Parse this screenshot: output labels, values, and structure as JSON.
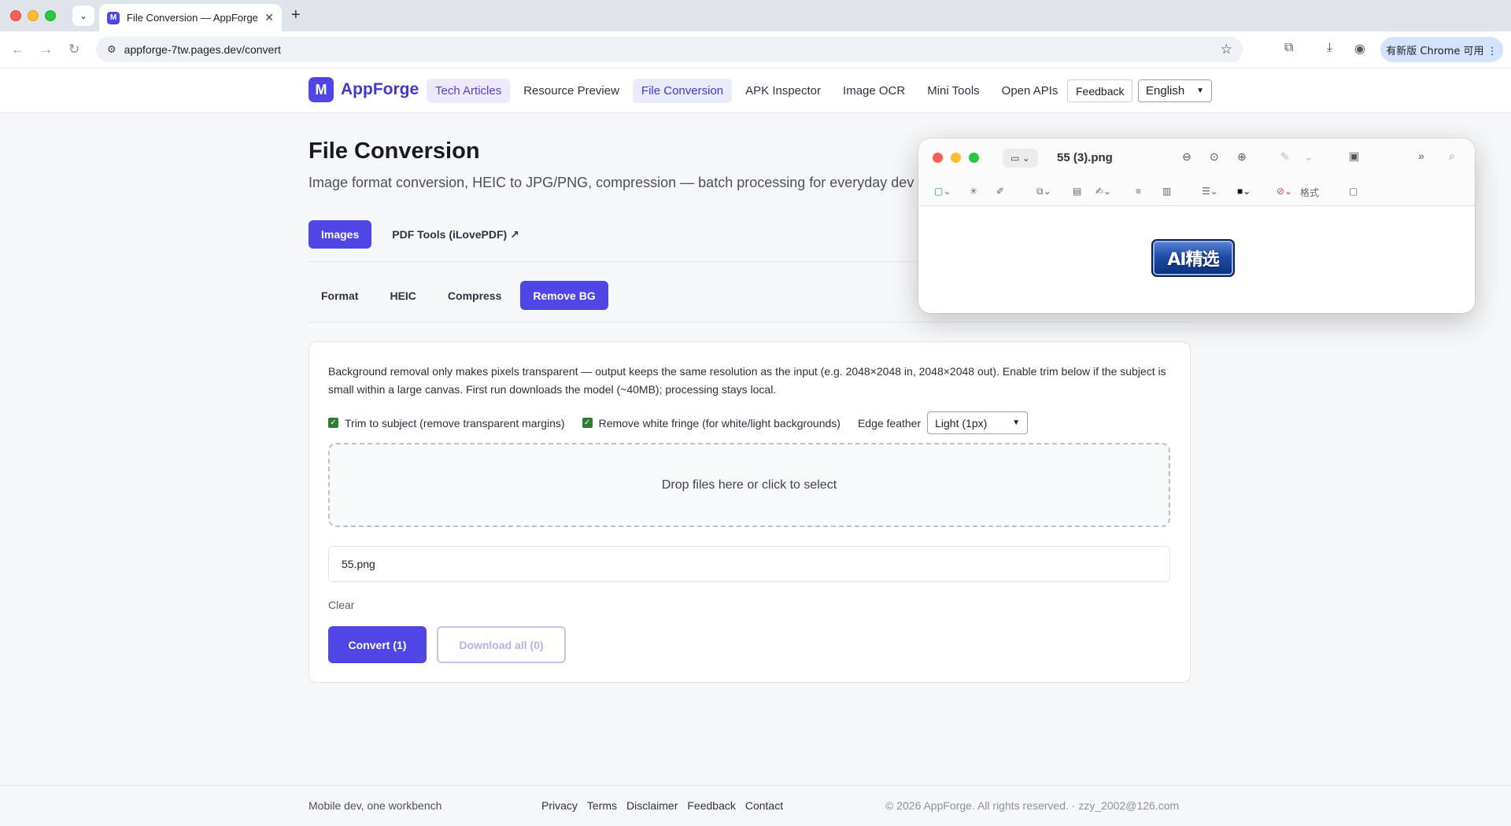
{
  "browser": {
    "tab_title": "File Conversion — AppForge",
    "favicon_letter": "M",
    "url": "appforge-7tw.pages.dev/convert",
    "update_label": "有新版 Chrome 可用 ⋮"
  },
  "site": {
    "logo_letter": "M",
    "logo_text": "AppForge",
    "nav": [
      {
        "label": "Tech Articles"
      },
      {
        "label": "Resource Preview"
      },
      {
        "label": "File Conversion"
      },
      {
        "label": "APK Inspector"
      },
      {
        "label": "Image OCR"
      },
      {
        "label": "Mini Tools"
      },
      {
        "label": "Open APIs"
      }
    ],
    "feedback_label": "Feedback",
    "language": "English"
  },
  "main": {
    "title": "File Conversion",
    "subtitle": "Image format conversion, HEIC to JPG/PNG, compression — batch processing for everyday dev a",
    "categories": [
      {
        "label": "Images"
      },
      {
        "label": "PDF Tools (iLovePDF) ↗"
      }
    ],
    "subtabs": [
      {
        "label": "Format"
      },
      {
        "label": "HEIC"
      },
      {
        "label": "Compress"
      },
      {
        "label": "Remove BG"
      }
    ],
    "card": {
      "description": "Background removal only makes pixels transparent — output keeps the same resolution as the input (e.g. 2048×2048 in, 2048×2048 out). Enable trim below if the subject is small within a large canvas. First run downloads the model (~40MB); processing stays local.",
      "trim_label": "Trim to subject (remove transparent margins)",
      "fringe_label": "Remove white fringe (for white/light backgrounds)",
      "feather_label": "Edge feather",
      "feather_value": "Light (1px)",
      "dropzone_text": "Drop files here or click to select",
      "file_name": "55.png",
      "clear_label": "Clear",
      "convert_label": "Convert (1)",
      "download_label": "Download all (0)"
    }
  },
  "footer": {
    "tagline": "Mobile dev, one workbench",
    "links": [
      {
        "label": "Privacy"
      },
      {
        "label": "Terms"
      },
      {
        "label": "Disclaimer"
      },
      {
        "label": "Feedback"
      },
      {
        "label": "Contact"
      }
    ],
    "copyright": "© 2026 AppForge. All rights reserved. · zzy_2002@126.com"
  },
  "preview": {
    "title": "55 (3).png",
    "format_label": "格式",
    "badge_text": "AI精选"
  },
  "colors": {
    "accent": "#4f46e5",
    "check_green": "#2e7d32"
  }
}
